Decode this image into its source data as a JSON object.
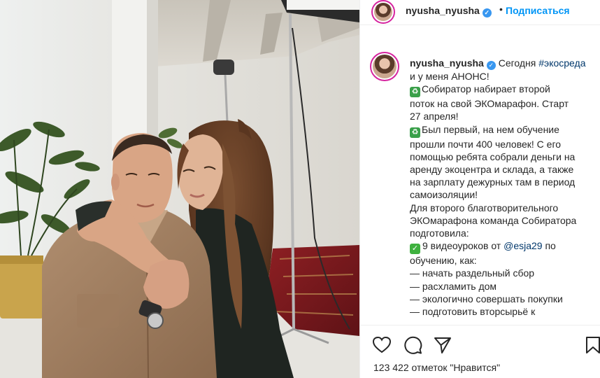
{
  "post": {
    "username": "nyusha_nyusha",
    "follow_label": "Подписаться",
    "header_separator": "•",
    "verified_symbol": "✓"
  },
  "caption": {
    "username": "nyusha_nyusha",
    "lines": [
      "Сегодня",
      "#экосреда",
      "и у меня АНОНС!",
      "Собиратор набирает второй",
      "поток на свой ЭКОмарафон. Старт",
      "27 апреля!",
      "Был первый, на нем обучение",
      "прошли почти 400 человек! С его",
      "помощью ребята собрали деньги на",
      "аренду экоцентра и склада, а также",
      "на зарплату дежурных там в период",
      "самоизоляции!",
      "Для второго благотворительного",
      "ЭКОмарафона команда Собиратора",
      "подготовила:",
      "9 видеоуроков от",
      "@esja29",
      "по",
      "обучению, как:",
      "— начать раздельный сбор",
      "— расхламить дом",
      "— экологично совершать покупки",
      "— подготовить вторсырьё к"
    ]
  },
  "actions": {
    "like_icon": "heart-icon",
    "comment_icon": "comment-icon",
    "share_icon": "paper-plane-icon",
    "save_icon": "bookmark-icon",
    "likes_text": "123 422 отметок \"Нравится\""
  },
  "colors": {
    "link": "#00376b",
    "follow": "#0095f6",
    "verified": "#3897f0",
    "recycle_emoji": "#3aa04a"
  }
}
